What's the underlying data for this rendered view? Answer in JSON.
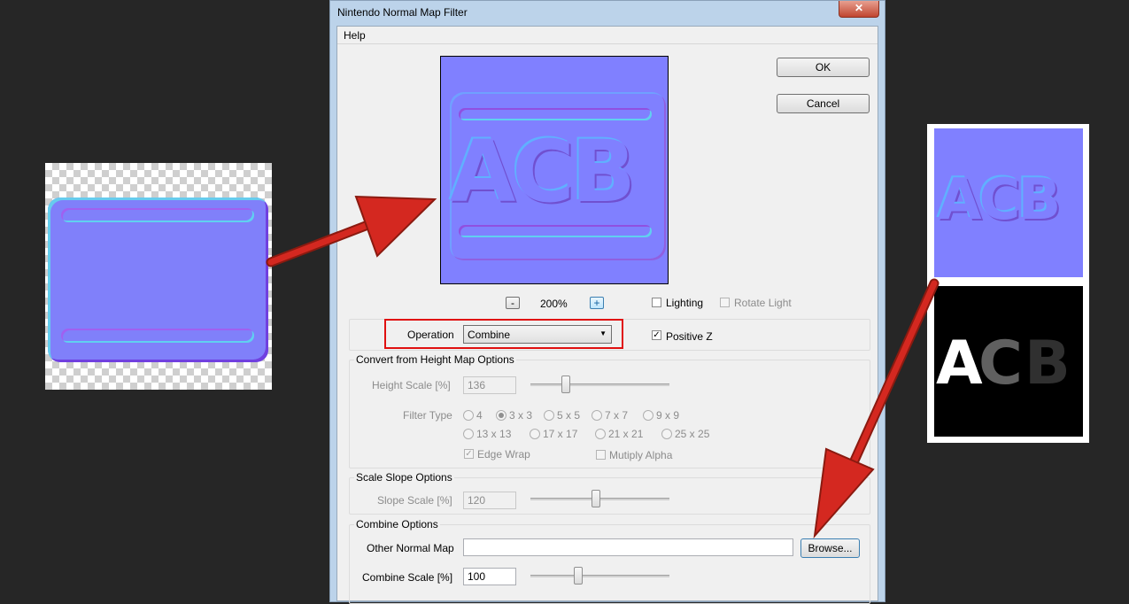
{
  "dialog": {
    "title": "Nintendo Normal Map Filter",
    "close_glyph": "✕",
    "menu": {
      "help": "Help"
    },
    "preview_text": "ACB",
    "ok_label": "OK",
    "cancel_label": "Cancel",
    "zoom": {
      "minus": "-",
      "value": "200%",
      "plus": "+"
    },
    "lighting_label": "Lighting",
    "rotate_light_label": "Rotate Light",
    "operation": {
      "label": "Operation",
      "value": "Combine",
      "arrow": "▼"
    },
    "positive_z_label": "Positive Z",
    "height_map": {
      "group_title": "Convert from Height Map Options",
      "height_scale_label": "Height Scale [%]",
      "height_scale_value": "136",
      "filter_type_label": "Filter Type",
      "filter_types": [
        "4",
        "3 x 3",
        "5 x 5",
        "7 x 7",
        "9 x 9",
        "13 x 13",
        "17 x 17",
        "21 x 21",
        "25 x 25"
      ],
      "selected_filter": "3 x 3",
      "edge_wrap_label": "Edge Wrap",
      "multiply_alpha_label": "Mutiply Alpha"
    },
    "slope": {
      "group_title": "Scale Slope Options",
      "slope_scale_label": "Slope Scale [%]",
      "slope_scale_value": "120"
    },
    "combine": {
      "group_title": "Combine Options",
      "other_map_label": "Other Normal Map",
      "other_map_value": "",
      "browse_label": "Browse...",
      "combine_scale_label": "Combine Scale [%]",
      "combine_scale_value": "100"
    }
  },
  "right_image": {
    "text": "ACB"
  },
  "colors": {
    "normal_map": "#8080ff",
    "highlight_red": "#e01010",
    "arrow_red": "#d42820"
  }
}
